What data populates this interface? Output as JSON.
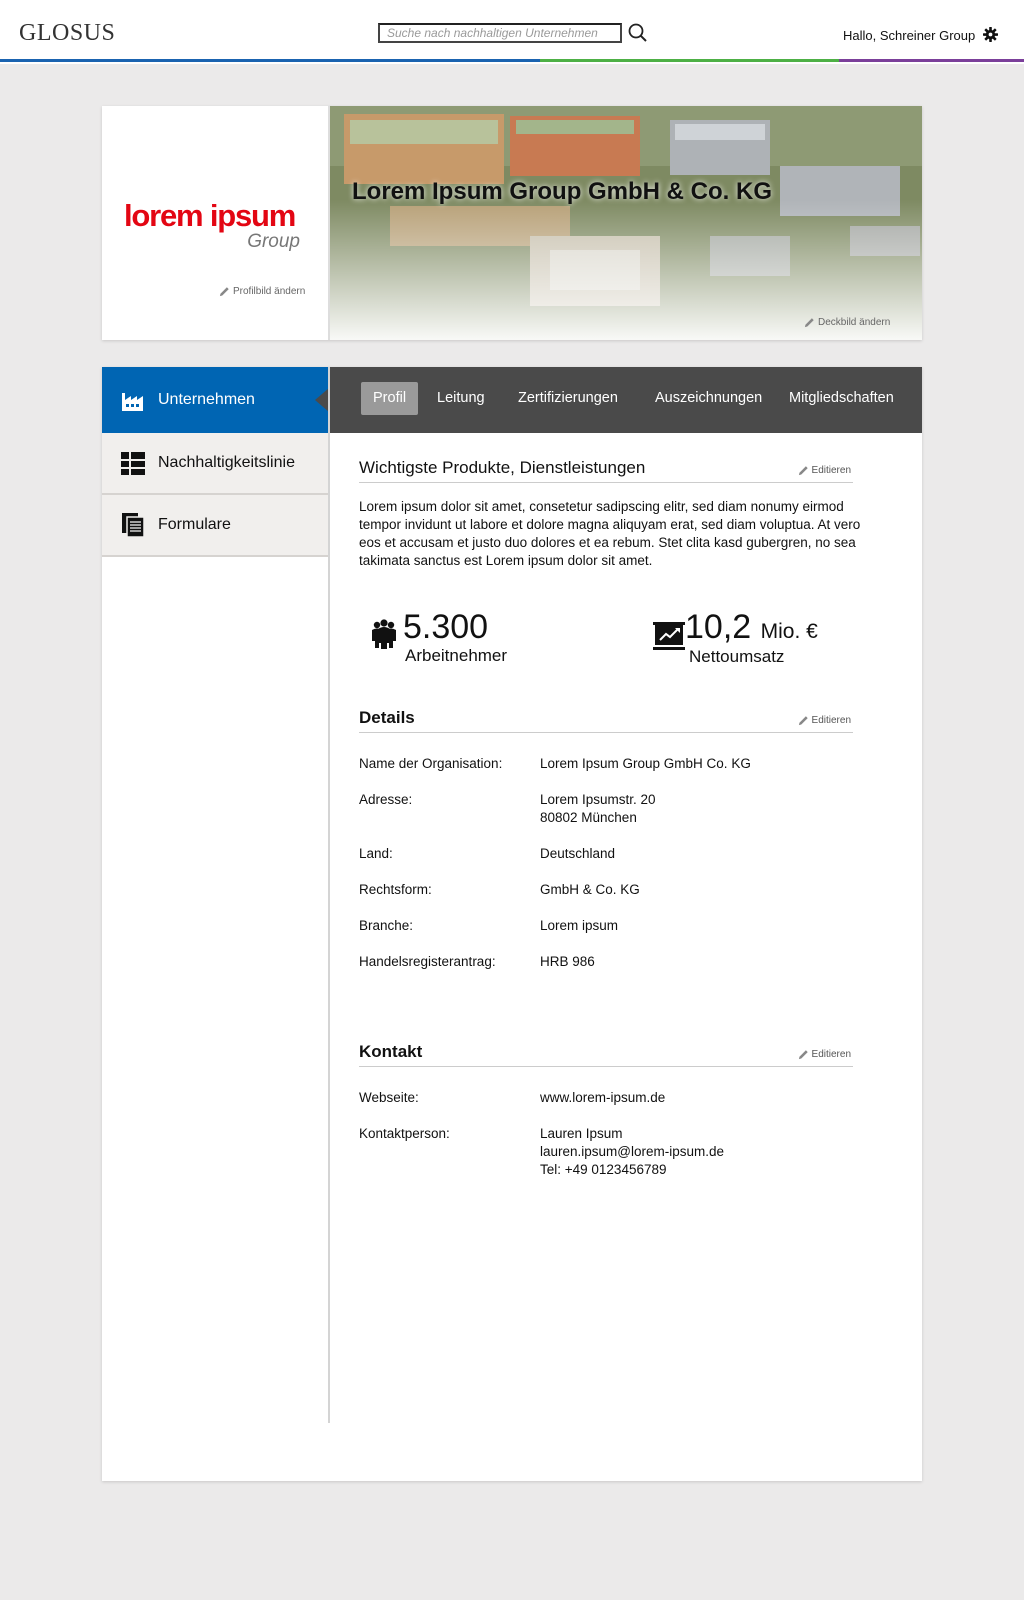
{
  "header": {
    "logo": "GLOSUS",
    "search_placeholder": "Suche nach nachhaltigen Unternehmen",
    "greeting": "Hallo, Schreiner Group",
    "stripe_colors": [
      "#1a63b0",
      "#4db045",
      "#7b3f9a"
    ]
  },
  "hero": {
    "brand_main": "lorem ipsum",
    "brand_sub": "Group",
    "change_profile": "Profilbild ändern",
    "company_name": "Lorem Ipsum Group GmbH & Co. KG",
    "change_cover": "Deckbild ändern"
  },
  "sidenav": {
    "items": [
      {
        "label": "Unternehmen",
        "icon": "factory-icon"
      },
      {
        "label": "Nachhaltigkeitslinie",
        "icon": "layout-icon"
      },
      {
        "label": "Formulare",
        "icon": "documents-icon"
      }
    ]
  },
  "tabs": [
    "Profil",
    "Leitung",
    "Zertifizierungen",
    "Auszeichnungen",
    "Mitgliedschaften"
  ],
  "products": {
    "title": "Wichtigste Produkte, Dienstleistungen",
    "edit": "Editieren",
    "text": "Lorem ipsum dolor sit amet, consetetur sadipscing elitr, sed diam nonumy eirmod tempor invidunt ut labore et dolore magna aliquyam erat, sed diam voluptua. At vero eos et accusam et justo duo dolores et ea rebum. Stet clita kasd gubergren, no sea takimata sanctus est Lorem ipsum dolor sit amet."
  },
  "stats": {
    "employees_value": "5.300",
    "employees_label": "Arbeitnehmer",
    "revenue_value": "10,2",
    "revenue_unit": "Mio. €",
    "revenue_label": "Nettoumsatz"
  },
  "details": {
    "title": "Details",
    "edit": "Editieren",
    "rows": [
      {
        "label": "Name der Organisation:",
        "value": "Lorem Ipsum Group GmbH Co. KG"
      },
      {
        "label": "Adresse:",
        "value": "Lorem Ipsumstr. 20",
        "value2": "80802 München"
      },
      {
        "label": "Land:",
        "value": "Deutschland"
      },
      {
        "label": "Rechtsform:",
        "value": "GmbH & Co. KG"
      },
      {
        "label": "Branche:",
        "value": "Lorem ipsum"
      },
      {
        "label": "Handelsregisterantrag:",
        "value": "HRB 986"
      }
    ]
  },
  "contact": {
    "title": "Kontakt",
    "edit": "Editieren",
    "website_label": "Webseite:",
    "website": "www.lorem-ipsum.de",
    "person_label": "Kontaktperson:",
    "person_name": "Lauren Ipsum",
    "person_email": "lauren.ipsum@lorem-ipsum.de",
    "person_phone": "Tel: +49 0123456789"
  }
}
